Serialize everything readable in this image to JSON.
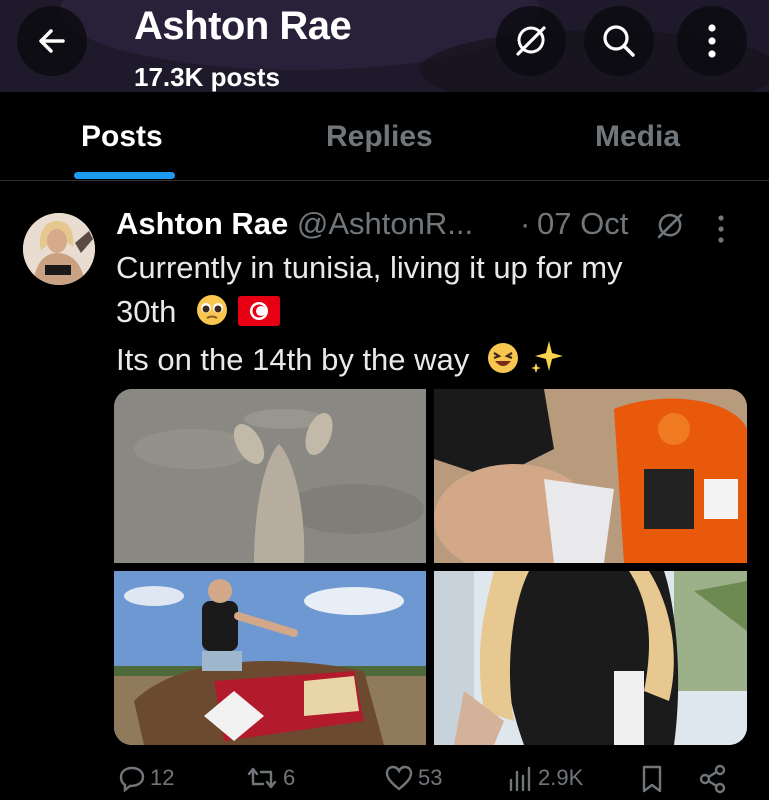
{
  "header": {
    "name": "Ashton Rae",
    "post_count": "17.3K posts",
    "icons": [
      "back-arrow-icon",
      "muted-icon",
      "search-icon",
      "more-vertical-icon"
    ]
  },
  "tabs": [
    {
      "label": "Posts",
      "active": true
    },
    {
      "label": "Replies",
      "active": false
    },
    {
      "label": "Media",
      "active": false
    }
  ],
  "post": {
    "author": "Ashton Rae",
    "handle": "@AshtonR...",
    "separator": "·",
    "date": "07 Oct",
    "line1": "Currently in tunisia, living it up for my",
    "line2": "30th",
    "line3": "Its on the 14th by the way",
    "emojis": [
      "pleading-face-emoji",
      "tunisia-flag-emoji",
      "laughing-face-emoji",
      "sparkles-emoji"
    ],
    "images": [
      "camel-head-on-sand-photo",
      "quad-bike-photo",
      "camel-ride-photo",
      "car-window-photo"
    ],
    "stats": {
      "replies": "12",
      "reposts": "6",
      "likes": "53",
      "views": "2.9K"
    }
  },
  "colors": {
    "accent": "#1d9bf0",
    "text": "#e7e9ea",
    "muted": "#71767b",
    "background": "#000000"
  }
}
